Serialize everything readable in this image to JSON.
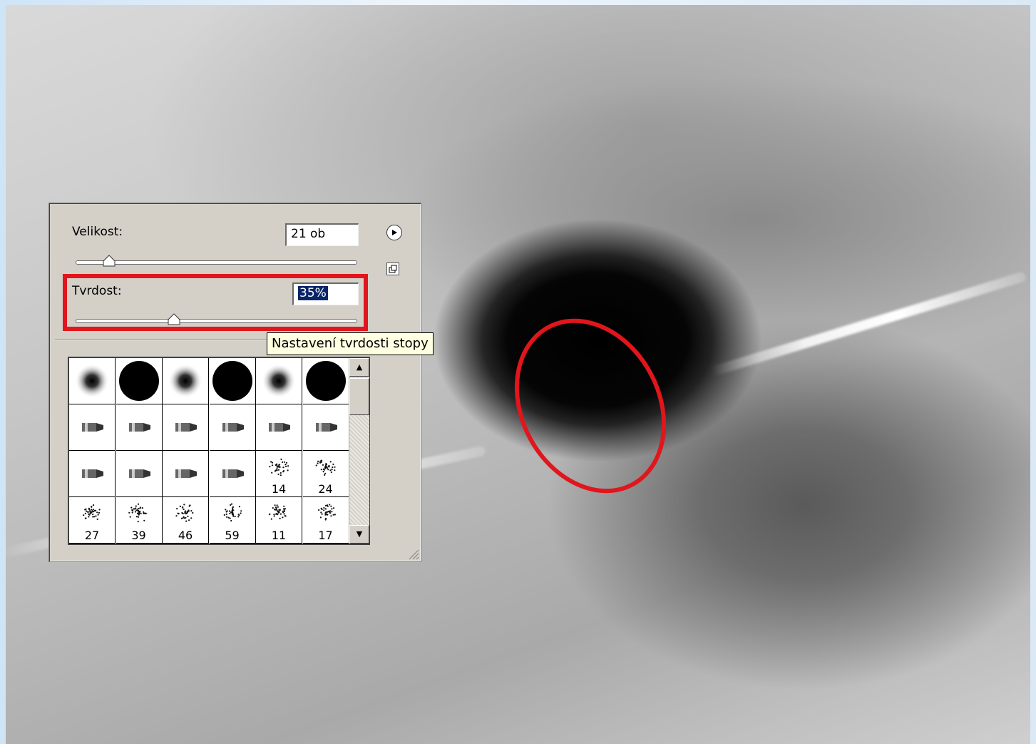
{
  "brush_panel": {
    "size_label": "Velikost:",
    "size_value": "21 ob",
    "size_slider_fraction": 0.12,
    "hardness_label": "Tvrdost:",
    "hardness_value": "35%",
    "hardness_slider_fraction": 0.35,
    "menu_icon": "play-circle-icon",
    "new_preset_icon": "new-preset-icon"
  },
  "tooltip": {
    "text": "Nastavení tvrdosti stopy"
  },
  "brush_presets": {
    "rows": [
      [
        {
          "kind": "soft-round",
          "label": ""
        },
        {
          "kind": "hard-round",
          "label": ""
        },
        {
          "kind": "soft-round",
          "label": ""
        },
        {
          "kind": "hard-round",
          "label": ""
        },
        {
          "kind": "soft-round",
          "label": ""
        },
        {
          "kind": "hard-round",
          "label": ""
        }
      ],
      [
        {
          "kind": "brush-tip",
          "label": ""
        },
        {
          "kind": "brush-tip",
          "label": ""
        },
        {
          "kind": "brush-tip",
          "label": ""
        },
        {
          "kind": "brush-tip",
          "label": ""
        },
        {
          "kind": "brush-tip",
          "label": ""
        },
        {
          "kind": "brush-tip",
          "label": ""
        }
      ],
      [
        {
          "kind": "brush-tip",
          "label": ""
        },
        {
          "kind": "brush-tip",
          "label": ""
        },
        {
          "kind": "brush-tip",
          "label": ""
        },
        {
          "kind": "brush-tip",
          "label": ""
        },
        {
          "kind": "splatter",
          "label": "14"
        },
        {
          "kind": "splatter",
          "label": "24"
        }
      ],
      [
        {
          "kind": "splatter",
          "label": "27"
        },
        {
          "kind": "splatter",
          "label": "39"
        },
        {
          "kind": "splatter",
          "label": "46"
        },
        {
          "kind": "splatter",
          "label": "59"
        },
        {
          "kind": "splatter",
          "label": "11"
        },
        {
          "kind": "splatter",
          "label": "17"
        }
      ]
    ]
  },
  "annotation_colors": {
    "highlight": "#e0161c",
    "selection": "#0a246a"
  }
}
